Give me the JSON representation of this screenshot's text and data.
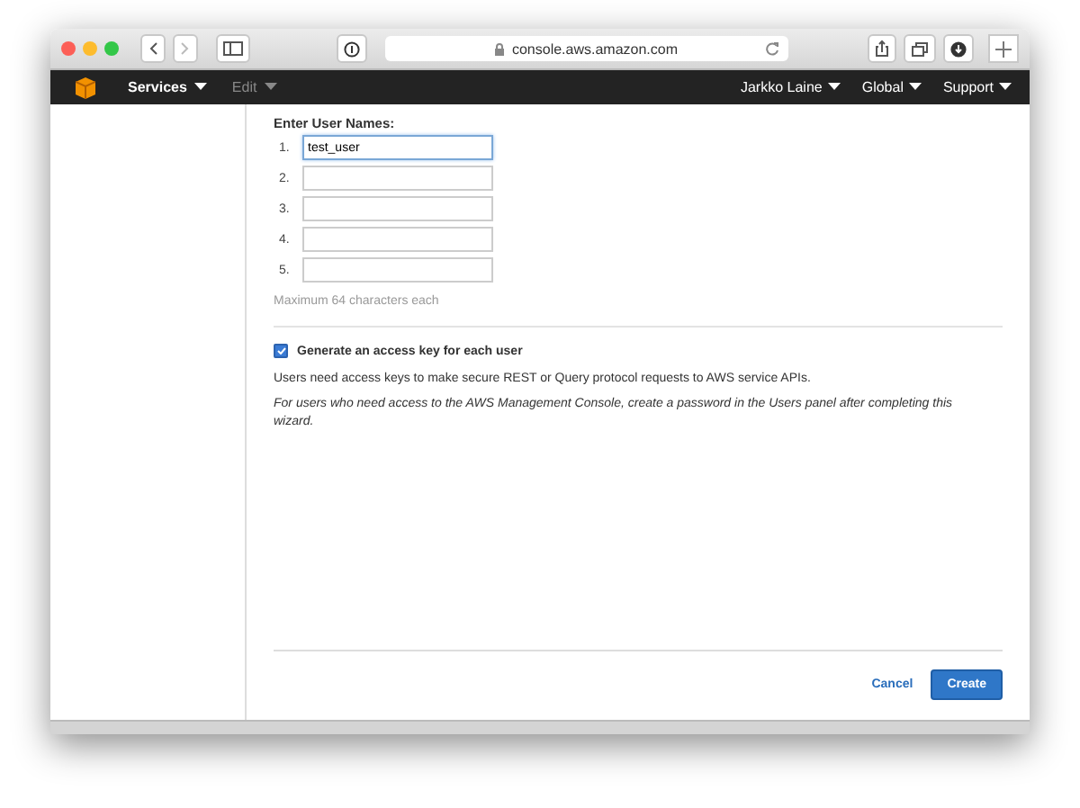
{
  "browser": {
    "url": "console.aws.amazon.com"
  },
  "navbar": {
    "items": [
      {
        "label": "Services",
        "disabled": false
      },
      {
        "label": "Edit",
        "disabled": true
      }
    ],
    "right_items": [
      "Jarkko Laine",
      "Global",
      "Support"
    ]
  },
  "form": {
    "heading": "Enter User Names:",
    "fields": [
      {
        "number": "1.",
        "value": "test_user",
        "focused": true
      },
      {
        "number": "2.",
        "focused": false
      },
      {
        "number": "3.",
        "focused": false
      },
      {
        "number": "4.",
        "focused": false
      },
      {
        "number": "5.",
        "focused": false
      }
    ],
    "hint": "Maximum 64 characters each",
    "access_key": {
      "label": "Generate an access key for each user",
      "checked": true
    },
    "info": "Users need access keys to make secure REST or Query protocol requests to AWS service APIs.",
    "note": "For users who need access to the AWS Management Console, create a password in the Users panel after completing this wizard."
  },
  "buttons": [
    {
      "label": "Cancel",
      "kind": "link"
    },
    {
      "label": "Create",
      "kind": "primary"
    }
  ]
}
